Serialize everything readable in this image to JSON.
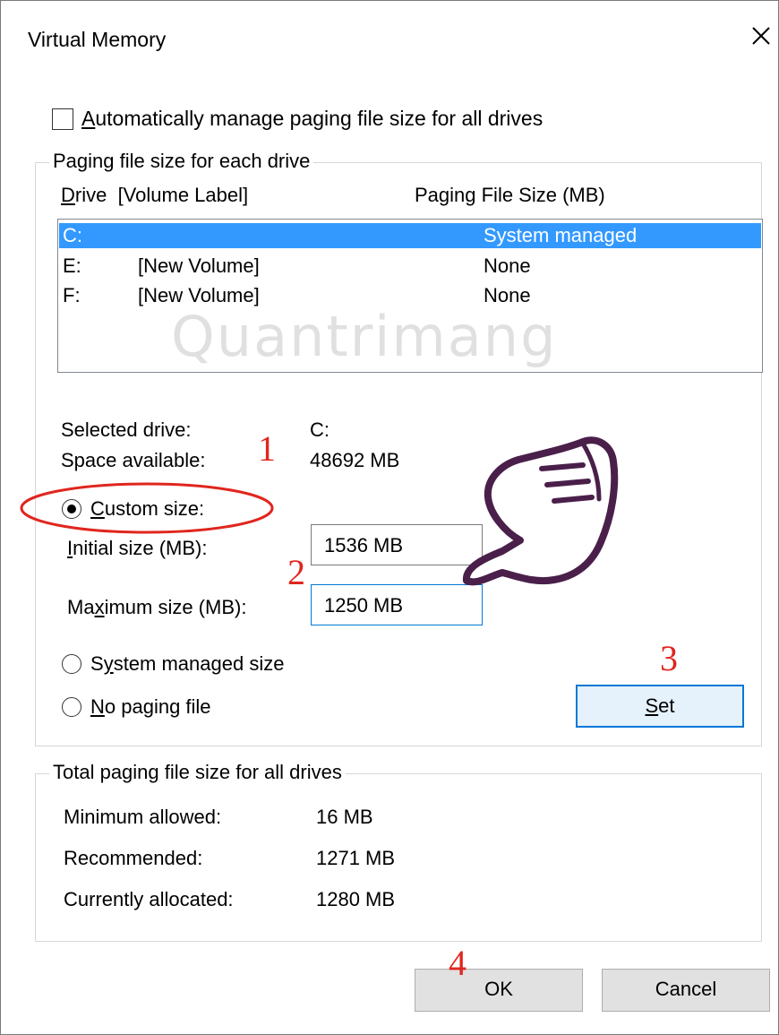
{
  "window": {
    "title": "Virtual Memory"
  },
  "auto_manage": {
    "label_accesskey": "A",
    "label_rest": "utomatically manage paging file size for all drives",
    "checked": false
  },
  "drive_group": {
    "legend": "Paging file size for each drive",
    "col_drive_accesskey": "D",
    "col_drive_rest": "rive  [Volume Label]",
    "col_size": "Paging File Size (MB)",
    "drives": [
      {
        "letter": "C:",
        "label": "",
        "size": "System managed"
      },
      {
        "letter": "E:",
        "label": "[New Volume]",
        "size": "None"
      },
      {
        "letter": "F:",
        "label": "[New Volume]",
        "size": "None"
      }
    ],
    "selected_drive_label": "Selected drive:",
    "selected_drive_value": "C:",
    "space_label": "Space available:",
    "space_value": "48692 MB",
    "custom_accesskey": "C",
    "custom_rest": "ustom size:",
    "initial_accesskey": "I",
    "initial_rest": "nitial size (MB):",
    "initial_value": "1536 MB",
    "max_pre": "Ma",
    "max_accesskey": "x",
    "max_rest": "imum size (MB):",
    "max_value": "1250 MB",
    "sys_pre": "S",
    "sys_accesskey": "y",
    "sys_rest": "stem managed size",
    "nopage_accesskey": "N",
    "nopage_rest": "o paging file",
    "set_accesskey": "S",
    "set_rest": "et"
  },
  "total_group": {
    "legend": "Total paging file size for all drives",
    "min_label": "Minimum allowed:",
    "min_value": "16 MB",
    "rec_label": "Recommended:",
    "rec_value": "1271 MB",
    "alloc_label": "Currently allocated:",
    "alloc_value": "1280 MB"
  },
  "buttons": {
    "ok": "OK",
    "cancel": "Cancel"
  },
  "annotations": [
    "1",
    "2",
    "3",
    "4"
  ],
  "watermark": "Quantrimang",
  "colors": {
    "selection": "#3399ff",
    "focus": "#0078d7",
    "annotation": "#e0261e"
  }
}
